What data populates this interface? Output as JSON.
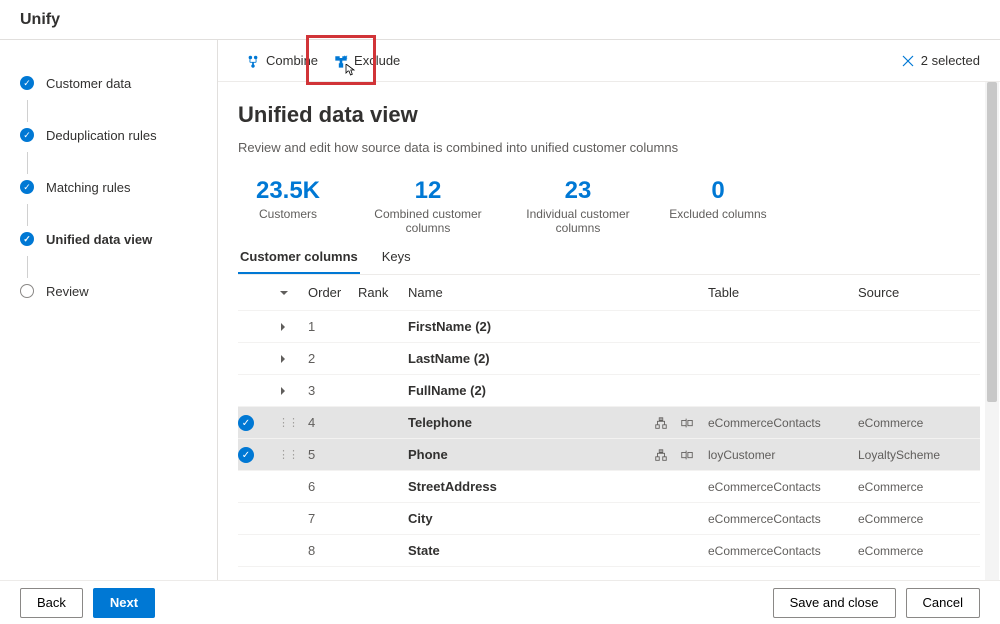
{
  "header": {
    "title": "Unify"
  },
  "sidebar": {
    "steps": [
      {
        "label": "Customer data",
        "state": "done"
      },
      {
        "label": "Deduplication rules",
        "state": "done"
      },
      {
        "label": "Matching rules",
        "state": "done"
      },
      {
        "label": "Unified data view",
        "state": "done",
        "active": true
      },
      {
        "label": "Review",
        "state": "pending"
      }
    ]
  },
  "toolbar": {
    "combine": "Combine",
    "exclude": "Exclude",
    "selected_count": "2 selected"
  },
  "page": {
    "title": "Unified data view",
    "subtitle": "Review and edit how source data is combined into unified customer columns"
  },
  "stats": [
    {
      "value": "23.5K",
      "label": "Customers"
    },
    {
      "value": "12",
      "label": "Combined customer columns"
    },
    {
      "value": "23",
      "label": "Individual customer columns"
    },
    {
      "value": "0",
      "label": "Excluded columns"
    }
  ],
  "tabs": {
    "columns": "Customer columns",
    "keys": "Keys"
  },
  "table": {
    "headers": {
      "order": "Order",
      "rank": "Rank",
      "name": "Name",
      "table": "Table",
      "source": "Source"
    },
    "rows": [
      {
        "expandable": true,
        "order": "1",
        "name": "FirstName (2)"
      },
      {
        "expandable": true,
        "order": "2",
        "name": "LastName (2)"
      },
      {
        "expandable": true,
        "order": "3",
        "name": "FullName (2)"
      },
      {
        "selected": true,
        "grip": true,
        "order": "4",
        "name": "Telephone",
        "icons": true,
        "table": "eCommerceContacts",
        "source": "eCommerce"
      },
      {
        "selected": true,
        "grip": true,
        "order": "5",
        "name": "Phone",
        "icons": true,
        "table": "loyCustomer",
        "source": "LoyaltyScheme"
      },
      {
        "order": "6",
        "name": "StreetAddress",
        "table": "eCommerceContacts",
        "source": "eCommerce"
      },
      {
        "order": "7",
        "name": "City",
        "table": "eCommerceContacts",
        "source": "eCommerce"
      },
      {
        "order": "8",
        "name": "State",
        "table": "eCommerceContacts",
        "source": "eCommerce"
      }
    ]
  },
  "footer": {
    "back": "Back",
    "next": "Next",
    "save": "Save and close",
    "cancel": "Cancel"
  }
}
